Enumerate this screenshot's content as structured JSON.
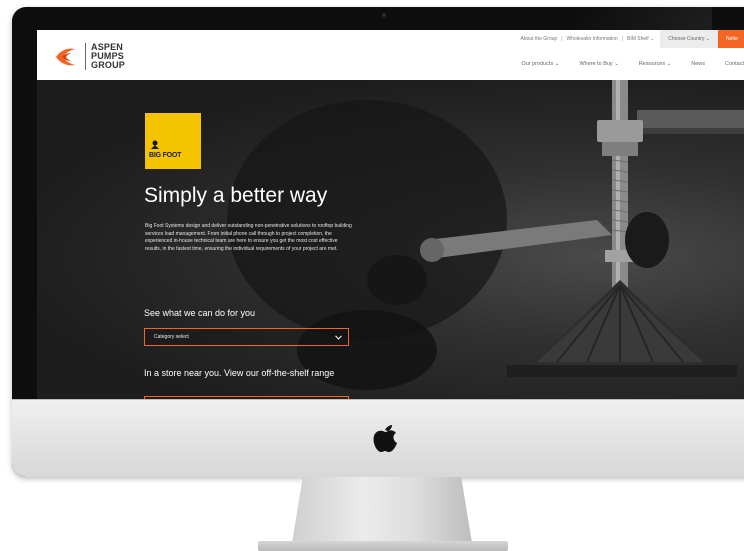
{
  "site": {
    "logo": {
      "line1": "ASPEN",
      "line2": "PUMPS",
      "line3": "GROUP"
    },
    "topbar": {
      "links": [
        "About the Group",
        "Wholesaler information",
        "BIM Shelf"
      ],
      "country_select": "Choose Country",
      "orange_tab": "Nette"
    },
    "nav": {
      "items": [
        "Our products",
        "Where to Buy",
        "Resources",
        "News",
        "Contact"
      ]
    },
    "hero": {
      "badge_text": "BIG FOOT",
      "title": "Simply a better way",
      "description": "Big Foot Systems design and deliver outstanding non-penetrative solutions to rooftop building services load management. From initial phone call through to project completion, the experienced in-house technical team are here to ensure you get the most cost effective results, in the fastest time, ensuring the individual requirements of your project are met.",
      "section1_heading": "See what we can do for you",
      "category_select_value": "Category select",
      "section2_heading": "In a store near you. View our off-the-shelf range"
    }
  },
  "colors": {
    "accent": "#f26522",
    "badge": "#f5c400"
  },
  "icons": [
    "apple-logo-icon",
    "aspen-logo-icon",
    "chevron-down-icon",
    "bigfoot-icon"
  ]
}
